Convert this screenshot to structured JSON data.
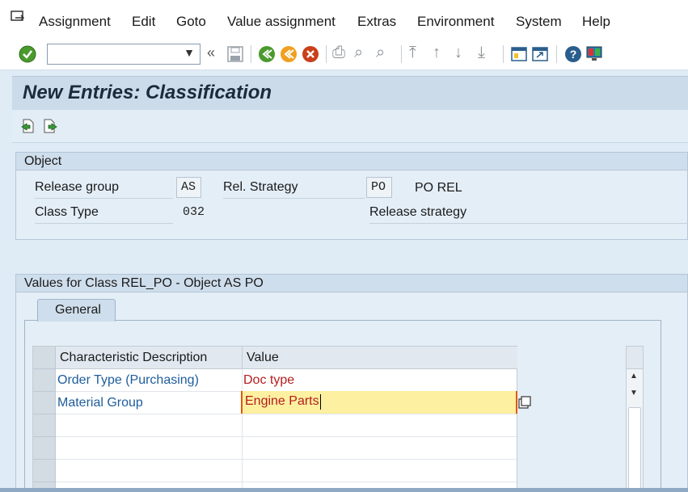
{
  "menu": {
    "items": [
      "Assignment",
      "Edit",
      "Goto",
      "Value assignment",
      "Extras",
      "Environment",
      "System",
      "Help"
    ]
  },
  "toolbar": {
    "command_field_value": "",
    "icons": [
      "enter-icon",
      "save-icon",
      "back-icon",
      "exit-icon",
      "cancel-icon",
      "print-icon",
      "find-icon",
      "find-next-icon",
      "first-page-icon",
      "previous-page-icon",
      "next-page-icon",
      "last-page-icon",
      "create-session-icon",
      "shortcut-icon",
      "help-icon",
      "customize-layout-icon"
    ]
  },
  "title": "New Entries: Classification",
  "object_group": {
    "title": "Object",
    "release_group_label": "Release group",
    "release_group_value": "AS",
    "rel_strategy_label": "Rel. Strategy",
    "rel_strategy_value": "PO",
    "rel_strategy_desc": "PO REL",
    "class_type_label": "Class Type",
    "class_type_value": "032",
    "release_strategy_label": "Release strategy"
  },
  "values_group": {
    "title": "Values for Class REL_PO - Object AS PO",
    "tab_label": "General",
    "columns": [
      "Characteristic Description",
      "Value"
    ],
    "rows": [
      {
        "description": "Order Type (Purchasing)",
        "value": "Doc type"
      },
      {
        "description": "Material Group",
        "value": "Engine Parts"
      }
    ]
  },
  "colors": {
    "accent_link": "#1f5d9c",
    "value_text": "#b41e1e",
    "edit_field_bg": "#fdf0a0"
  }
}
